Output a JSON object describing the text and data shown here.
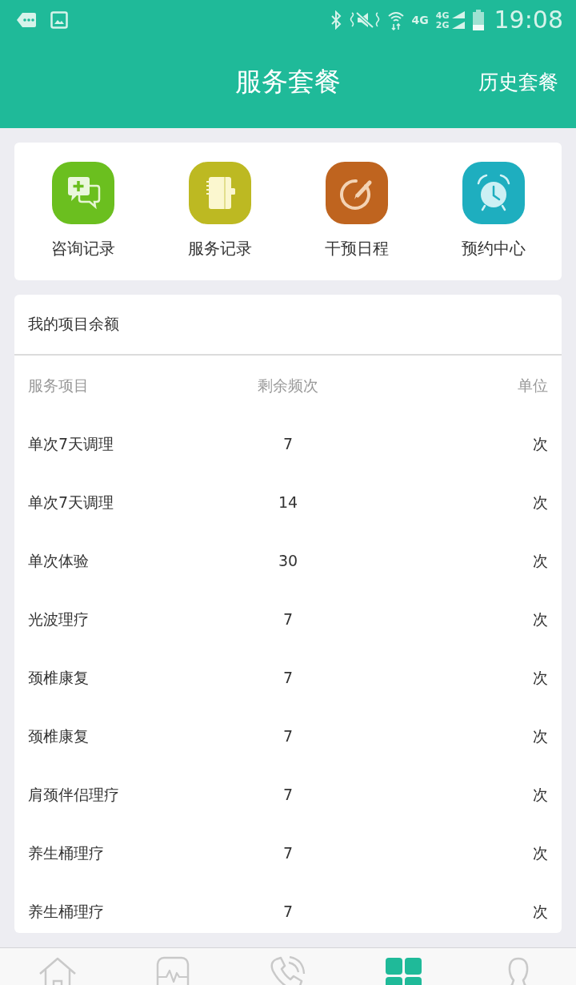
{
  "status_bar": {
    "network": "4G",
    "network_top": "4G",
    "network_bottom": "2G",
    "time": "19:08"
  },
  "header": {
    "title": "服务套餐",
    "action": "历史套餐"
  },
  "shortcuts": [
    {
      "kind": "chat",
      "label": "咨询记录",
      "color": "#6bbf1f"
    },
    {
      "kind": "notebook",
      "label": "服务记录",
      "color": "#bdb922"
    },
    {
      "kind": "schedule",
      "label": "干预日程",
      "color": "#bf641f"
    },
    {
      "kind": "alarm",
      "label": "预约中心",
      "color": "#1eaebf"
    }
  ],
  "balance": {
    "title": "我的项目余额",
    "columns": [
      "服务项目",
      "剩余频次",
      "单位"
    ],
    "rows": [
      {
        "item": "单次7天调理",
        "remaining": "7",
        "unit": "次"
      },
      {
        "item": "单次7天调理",
        "remaining": "14",
        "unit": "次"
      },
      {
        "item": "单次体验",
        "remaining": "30",
        "unit": "次"
      },
      {
        "item": "光波理疗",
        "remaining": "7",
        "unit": "次"
      },
      {
        "item": "颈椎康复",
        "remaining": "7",
        "unit": "次"
      },
      {
        "item": "颈椎康复",
        "remaining": "7",
        "unit": "次"
      },
      {
        "item": "肩颈伴侣理疗",
        "remaining": "7",
        "unit": "次"
      },
      {
        "item": "养生桶理疗",
        "remaining": "7",
        "unit": "次"
      },
      {
        "item": "养生桶理疗",
        "remaining": "7",
        "unit": "次"
      }
    ]
  },
  "tab_bar": [
    {
      "kind": "home",
      "selected": false
    },
    {
      "kind": "monitor",
      "selected": false
    },
    {
      "kind": "phone",
      "selected": false
    },
    {
      "kind": "grid",
      "selected": true
    },
    {
      "kind": "person",
      "selected": false
    }
  ]
}
